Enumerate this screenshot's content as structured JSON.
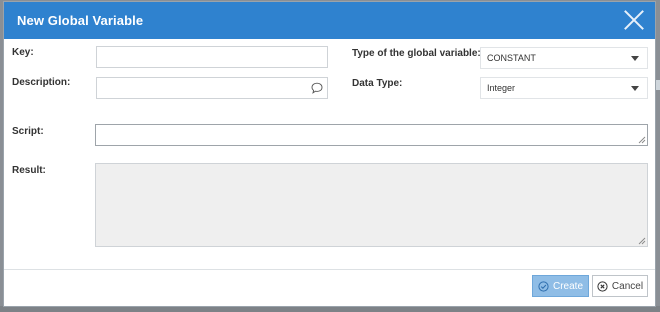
{
  "dialog": {
    "title": "New Global Variable",
    "close_icon": "close-icon"
  },
  "form": {
    "key_label": "Key:",
    "key_value": "",
    "description_label": "Description:",
    "description_value": "",
    "description_icon": "chat-bubble-icon",
    "type_label": "Type of the global variable:",
    "type_value": "CONSTANT",
    "data_type_label": "Data Type:",
    "data_type_value": "Integer",
    "script_label": "Script:",
    "result_label": "Result:"
  },
  "footer": {
    "create_label": "Create",
    "cancel_label": "Cancel"
  },
  "colors": {
    "titlebar": "#2f82cf",
    "create_button": "#8fbde6"
  }
}
